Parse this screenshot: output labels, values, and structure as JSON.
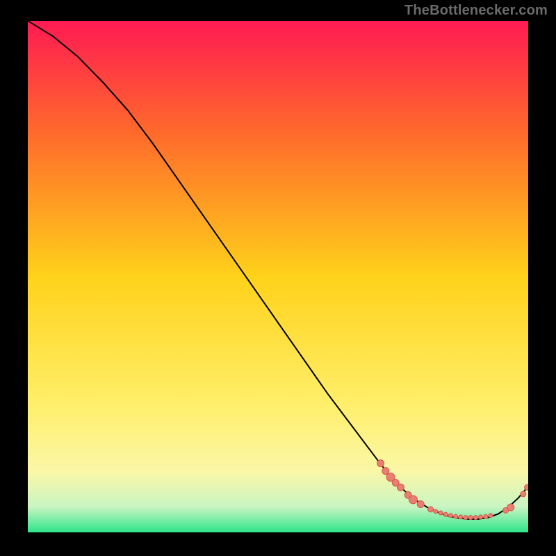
{
  "attribution": "TheBottlenecker.com",
  "colors": {
    "bg_black": "#000000",
    "grad_top": "#ff1a52",
    "grad_upper": "#ff6a2b",
    "grad_mid": "#ffd21a",
    "grad_yellow_soft": "#ffef6a",
    "grad_yellow_pale": "#fbf7a7",
    "grad_green_pale": "#c9f5c2",
    "grad_green": "#2fe58a",
    "line": "#000000",
    "dot_fill": "#e97f71",
    "dot_stroke": "#d15a4d",
    "attribution_text": "#6b6b6b"
  },
  "chart_data": {
    "type": "line",
    "title": "",
    "xlabel": "",
    "ylabel": "",
    "xlim": [
      0,
      100
    ],
    "ylim": [
      0,
      100
    ],
    "series": [
      {
        "name": "curve",
        "x": [
          0,
          5,
          10,
          15,
          20,
          25,
          30,
          35,
          40,
          45,
          50,
          55,
          60,
          65,
          70,
          72,
          74,
          76,
          78,
          80,
          82,
          84,
          86,
          88,
          90,
          92,
          94,
          96,
          98,
          100
        ],
        "y": [
          100,
          97,
          93,
          88,
          82.5,
          76,
          69,
          62,
          55,
          48,
          41,
          34,
          27,
          20.5,
          14,
          11.5,
          9.3,
          7.5,
          6.0,
          4.8,
          3.9,
          3.2,
          2.8,
          2.6,
          2.6,
          2.9,
          3.6,
          4.9,
          6.7,
          9.0
        ]
      }
    ],
    "scatter_points": [
      {
        "x": 70.5,
        "y": 13.5,
        "r": 5
      },
      {
        "x": 71.5,
        "y": 12.0,
        "r": 5
      },
      {
        "x": 72.5,
        "y": 10.8,
        "r": 6
      },
      {
        "x": 73.5,
        "y": 9.7,
        "r": 5
      },
      {
        "x": 74.5,
        "y": 8.8,
        "r": 5
      },
      {
        "x": 76.0,
        "y": 7.3,
        "r": 5
      },
      {
        "x": 77.0,
        "y": 6.4,
        "r": 6
      },
      {
        "x": 78.5,
        "y": 5.5,
        "r": 5
      },
      {
        "x": 80.5,
        "y": 4.5,
        "r": 4
      },
      {
        "x": 81.5,
        "y": 4.1,
        "r": 3
      },
      {
        "x": 82.5,
        "y": 3.8,
        "r": 3
      },
      {
        "x": 83.5,
        "y": 3.5,
        "r": 3
      },
      {
        "x": 84.5,
        "y": 3.3,
        "r": 3
      },
      {
        "x": 85.5,
        "y": 3.1,
        "r": 3
      },
      {
        "x": 86.5,
        "y": 3.0,
        "r": 3
      },
      {
        "x": 87.5,
        "y": 2.9,
        "r": 3
      },
      {
        "x": 88.5,
        "y": 2.9,
        "r": 3
      },
      {
        "x": 89.5,
        "y": 2.9,
        "r": 3
      },
      {
        "x": 90.5,
        "y": 3.0,
        "r": 3
      },
      {
        "x": 91.5,
        "y": 3.1,
        "r": 3
      },
      {
        "x": 92.5,
        "y": 3.3,
        "r": 3
      },
      {
        "x": 95.5,
        "y": 4.3,
        "r": 4
      },
      {
        "x": 96.5,
        "y": 4.9,
        "r": 5
      },
      {
        "x": 99.0,
        "y": 7.5,
        "r": 4
      },
      {
        "x": 99.8,
        "y": 8.8,
        "r": 4
      }
    ]
  }
}
